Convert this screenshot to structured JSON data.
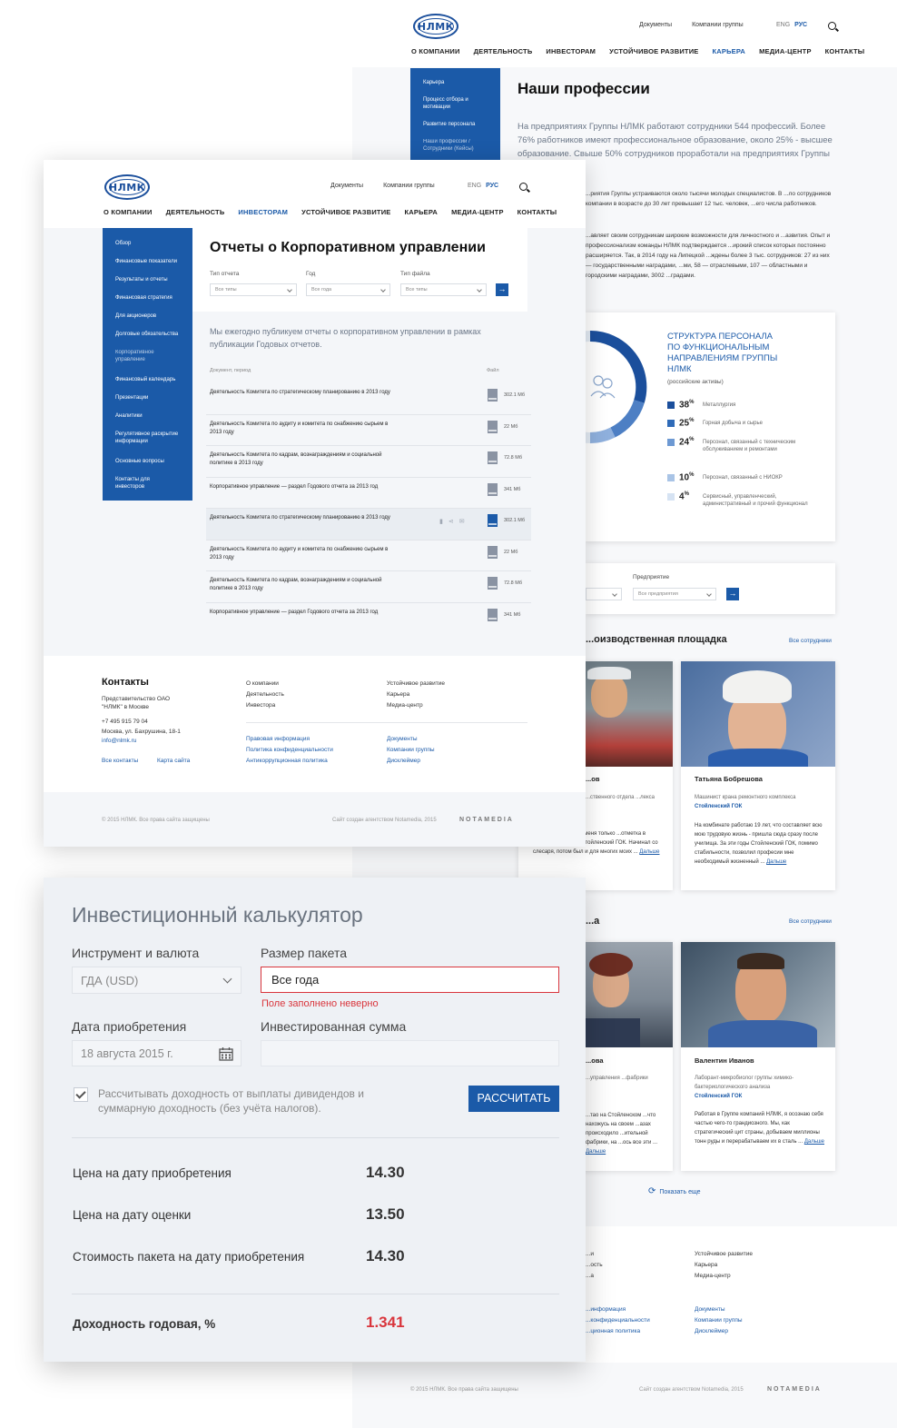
{
  "career": {
    "logo": "НЛМК",
    "toplinks": [
      "Документы",
      "Компании группы"
    ],
    "lang_en": "ENG",
    "lang_ru": "РУС",
    "nav": [
      "О КОМПАНИИ",
      "ДЕЯТЕЛЬНОСТЬ",
      "ИНВЕСТОРАМ",
      "УСТОЙЧИВОЕ РАЗВИТИЕ",
      "КАРЬЕРА",
      "МЕДИА-ЦЕНТР",
      "КОНТАКТЫ"
    ],
    "sidebar": [
      "Карьера",
      "Процесс отбора и мотивации",
      "Развитие персонала",
      "Наши профессии / Сотрудники (Кейсы)"
    ],
    "title": "Наши профессии",
    "intro": "На предприятиях Группы НЛМК работают сотрудники 544 профессий. Более 76% работников имеют профессиональное образование, около 25% - высшее образование. Свыше 50% сотрудников проработали на предприятиях Группы ...ет.",
    "para2": "...риятия Группы устраиваются около тысячи молодых специалистов. В ...ло сотрудников компании в возрасте до 30 лет превышает 12 тыс. человек, ...его числа работников.",
    "para3": "...авляет своим сотрудникам широкие возможности для личностного и ...азвития. Опыт и профессионализм команды НЛМК подтверждается ...ирокий список которых постоянно расширяется. Так, в 2014 году на Липецкой ...ждены более 3 тыс. сотрудников: 27 из них — государственными наградами, ...ми, 58 — отраслевыми, 107 — областными и городскими наградами, 3002 ...градами.",
    "structure_title": "СТРУКТУРА ПЕРСОНАЛА ПО ФУНКЦИОНАЛЬНЫМ НАПРАВЛЕНИЯМ ГРУППЫ НЛМК",
    "structure_sub": "(российские активы)",
    "legend": [
      {
        "pct": "38",
        "label": "Металлургия",
        "color": "#1b4f9c"
      },
      {
        "pct": "25",
        "label": "Горная добыча и сырье",
        "color": "#2f6bb8"
      },
      {
        "pct": "24",
        "label": "Персонал, связанный с техническим обслуживанием и ремонтами",
        "color": "#6d99d3"
      },
      {
        "pct": "10",
        "label": "Персонал, связанный с НИОКР",
        "color": "#a9c4e6"
      },
      {
        "pct": "4",
        "label": "Сервисный, управленческий, административный и прочий функционал",
        "color": "#d6e3f3"
      }
    ],
    "filter_label": "Предприятие",
    "filter_value": "Все предприятия",
    "section1": "...оизводственная площадка",
    "all_staff": "Все сотрудники",
    "person1": {
      "name": "Татьяна Бобрешова",
      "role": "Машинист крана ремонтного комплекса",
      "company": "Стойленский ГОК",
      "text": "На комбинате работаю 19 лет, что составляет всю мою трудовую жизнь - пришла сюда сразу после училища. За эти годы Стойленский ГОК, помимо стабильности, позволил професии мне необходимый жизненный",
      "more": "Дальше"
    },
    "partial1": {
      "name": "...ов",
      "role": "...ственного отдела ...лекса",
      "text": "...д и пришел на ...у меня только ...отметка в трудовой книжке – Стойленский ГОК. Начинал со слесаря, потом был и для многих моих",
      "more": "Дальше"
    },
    "section2": "...а",
    "person2": {
      "name": "Валентин Иванов",
      "role": "Лаборант-микробиолог группы химико-бактериологического анализа",
      "company": "Стойленский ГОК",
      "text": "Работая в Группе компаний НЛМК, я осознаю себя частью чего-то грандиозного. Мы, как стратегический цит страны, добываем миллионы тонн руды и перерабатываем их в сталь",
      "more": "Дальше"
    },
    "partial2": {
      "name": "...ова",
      "role": "...управления ...фабрики",
      "text": "...тао на Стойленском ...что нахожусь на своем ...азах происходило ...ительной фабрики, на ...ось все эти",
      "more": "Дальше"
    },
    "show_more": "Показать еще",
    "footer_links": [
      "Устойчивое развитие",
      "Карьера",
      "Медиа-центр"
    ],
    "footer_links2": [
      "Документы",
      "Компании группы",
      "Дисклеймер"
    ],
    "footer_partial": [
      "...и",
      "...ость",
      "...а"
    ],
    "footer_partial2": [
      "...информация",
      "...конфиденциальности",
      "...ционная политика"
    ],
    "copyright": "© 2015 НЛМК. Все права сайта защищены",
    "agency": "Сайт создан агентством Notamedia, 2015",
    "notamedia": "NOTAMEDIA"
  },
  "reports": {
    "logo": "НЛМК",
    "toplinks": [
      "Документы",
      "Компании группы"
    ],
    "lang_en": "ENG",
    "lang_ru": "РУС",
    "nav": [
      "О КОМПАНИИ",
      "ДЕЯТЕЛЬНОСТЬ",
      "ИНВЕСТОРАМ",
      "УСТОЙЧИВОЕ РАЗВИТИЕ",
      "КАРЬЕРА",
      "МЕДИА-ЦЕНТР",
      "КОНТАКТЫ"
    ],
    "sidebar": [
      "Обзор",
      "Финансовые показатели",
      "Результаты и отчеты",
      "Финансовая стратегия",
      "Для акционеров",
      "Долговые обязательства",
      "Корпоративное управление",
      "Финансовый календарь",
      "Презентации",
      "Аналитики",
      "Регулятивное раскрытие информации",
      "Основные вопросы",
      "Контакты для инвесторов"
    ],
    "title": "Отчеты о Корпоративном управлении",
    "filters": [
      {
        "label": "Тип отчета",
        "value": "Все типы"
      },
      {
        "label": "Год",
        "value": "Все года"
      },
      {
        "label": "Тип файла",
        "value": "Все типы"
      }
    ],
    "intro": "Мы ежегодно публикуем отчеты о корпоративном управлении в рамках публикации Годовых отчетов.",
    "col_doc": "Документ, период",
    "col_file": "Файл",
    "rows": [
      {
        "title": "Деятельность Комитета по стратегическому планированию в 2013 году",
        "size": "302.1 Мб"
      },
      {
        "title": "Деятельность Комитета по аудиту и комитета по снабжению сырьем в 2013 году",
        "size": "22 Мб"
      },
      {
        "title": "Деятельность Комитета по кадрам, вознаграждениям и социальной политике в 2013 году",
        "size": "72.8 Мб"
      },
      {
        "title": "Корпоративное управление — раздел Годового отчета за 2013 год",
        "size": "341 Мб"
      },
      {
        "title": "Деятельность Комитета по стратегическому планированию в 2013 году",
        "size": "302.1 Мб"
      },
      {
        "title": "Деятельность Комитета по аудиту и комитета по снабжению сырьем в 2013 году",
        "size": "22 Мб"
      },
      {
        "title": "Деятельность Комитета по кадрам, вознаграждениям и социальной политике в 2013 году",
        "size": "72.8 Мб"
      },
      {
        "title": "Корпоративное управление — раздел Годового отчета за 2013 год",
        "size": "341 Мб"
      }
    ],
    "contacts_title": "Контакты",
    "contacts_rep": "Представительство ОАО \"НЛМК\" в Москве",
    "phone": "+7 495 915 79 04",
    "address": "Москва, ул. Бахрушина, 18-1",
    "email": "info@nlmk.ru",
    "all_contacts": "Все контакты",
    "sitemap": "Карта сайта",
    "col1": [
      "О компании",
      "Деятельность",
      "Инвестора"
    ],
    "col2": [
      "Устойчивое развитие",
      "Карьера",
      "Медиа-центр"
    ],
    "col1b": [
      "Правовая информация",
      "Политика конфиденциальности",
      "Антикоррупционная политика"
    ],
    "col2b": [
      "Документы",
      "Компании группы",
      "Дисклеймер"
    ],
    "copyright": "© 2015 НЛМК. Все права сайта защищены",
    "agency": "Сайт создан агентством Notamedia, 2015",
    "notamedia": "NOTAMEDIA"
  },
  "calc": {
    "title": "Инвестиционный калькулятор",
    "instrument_label": "Инструмент и валюта",
    "instrument_value": "ГДА (USD)",
    "package_label": "Размер пакета",
    "package_value": "Все года",
    "error": "Поле заполнено неверно",
    "date_label": "Дата приобретения",
    "date_value": "18 августа 2015 г.",
    "invested_label": "Инвестированная сумма",
    "checkbox_text": "Рассчитывать доходность от выплаты дивидендов и суммарную доходность (без учёта налогов).",
    "calc_button": "РАССЧИТАТЬ",
    "results": [
      {
        "label": "Цена на дату приобретения",
        "value": "14.30"
      },
      {
        "label": "Цена на дату оценки",
        "value": "13.50"
      },
      {
        "label": "Стоимость пакета на дату приобретения",
        "value": "14.30"
      }
    ],
    "yield_label": "Доходность годовая, %",
    "yield_value": "1.341",
    "colors": {
      "accent": "#1b5aa8",
      "error": "#d9353c"
    }
  }
}
